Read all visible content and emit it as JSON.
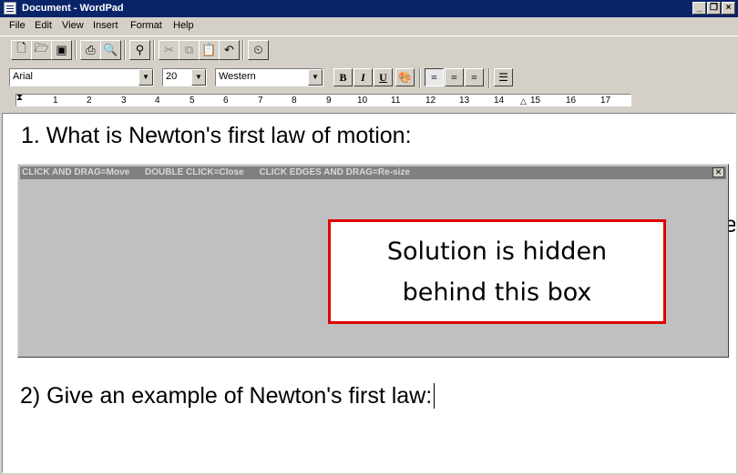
{
  "window": {
    "title": "Document - WordPad"
  },
  "menu": [
    "File",
    "Edit",
    "View",
    "Insert",
    "Format",
    "Help"
  ],
  "toolbar": {
    "icons": [
      "new-icon",
      "open-icon",
      "save-icon",
      "print-icon",
      "print-preview-icon",
      "find-icon",
      "cut-icon",
      "copy-icon",
      "paste-icon",
      "undo-icon",
      "date-time-icon"
    ]
  },
  "format": {
    "font": "Arial",
    "size": "20",
    "script": "Western",
    "bold": "B",
    "italic": "I",
    "underline": "U"
  },
  "ruler": {
    "labels": [
      "1",
      "2",
      "3",
      "4",
      "5",
      "6",
      "7",
      "8",
      "9",
      "10",
      "11",
      "12",
      "13",
      "14",
      "15",
      "16",
      "17"
    ]
  },
  "document": {
    "question1": "1. What is Newton's first law of motion:",
    "question2": "2) Give an example of Newton's first law:",
    "peek_char": "e"
  },
  "popup": {
    "hint_move": "CLICK AND DRAG=Move",
    "hint_close": "DOUBLE CLICK=Close",
    "hint_resize": "CLICK EDGES AND DRAG=Re-size",
    "close_glyph": "✕",
    "message_line1": "Solution is hidden",
    "message_line2": "behind this box",
    "border_color": "#e00000"
  }
}
